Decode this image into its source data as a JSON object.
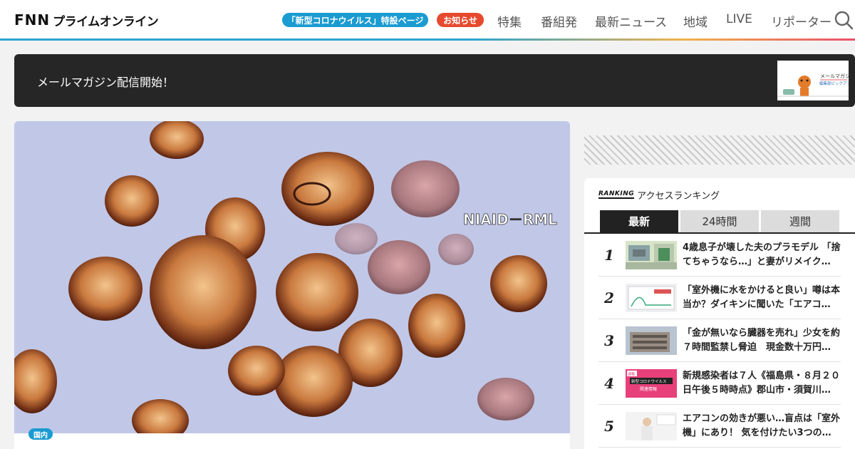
{
  "header": {
    "logo_main": "FNN",
    "logo_sub": "プライムオンライン",
    "pill_corona": "「新型コロナウイルス」特設ページ",
    "pill_news": "お知らせ",
    "nav": [
      "特集",
      "番組発",
      "最新ニュース",
      "地域",
      "LIVE",
      "リポーター"
    ]
  },
  "banner": {
    "text": "メールマガジン配信開始！",
    "thumb_title": "メールマガジン",
    "thumb_sub": "編集部ピックアップ"
  },
  "hero": {
    "watermark": "NIAID－RML",
    "tag": "国内"
  },
  "ranking": {
    "label_en": "RANKING",
    "title": "アクセスランキング",
    "tabs": [
      "最新",
      "24時間",
      "週間"
    ],
    "active_tab": "最新",
    "items": [
      {
        "rank": "1",
        "text": "4歳息子が壊した夫のプラモデル 「捨てちゃうなら…」と妻がリメイク…"
      },
      {
        "rank": "2",
        "text": "「室外機に水をかけると良い」噂は本当か？ダイキンに聞いた「エアコ…"
      },
      {
        "rank": "3",
        "text": "「金が無いなら臓器を売れ」少女を約７時間監禁し脅迫　現金数十万円…"
      },
      {
        "rank": "4",
        "text": "新規感染者は７人《福島県・８月２０日午後５時時点》郡山市・須賀川…",
        "thumb_label_1": "速報",
        "thumb_label_2": "新型コロナウイルス",
        "thumb_label_3": "関連情報"
      },
      {
        "rank": "5",
        "text": "エアコンの効きが悪い…盲点は「室外機」にあり！ 気を付けたい3つの…"
      }
    ]
  },
  "colors": {
    "accent_blue": "#1a9bd1",
    "accent_red": "#e6492d",
    "dark": "#262626"
  }
}
